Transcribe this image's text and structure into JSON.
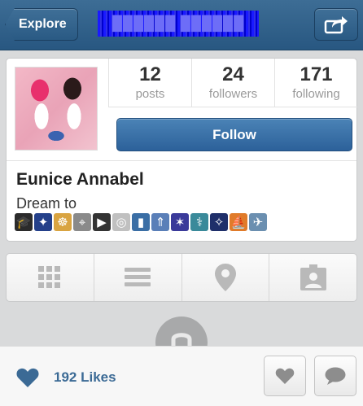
{
  "navbar": {
    "back_label": "Explore",
    "title": "██████ ██████"
  },
  "profile": {
    "stats": [
      {
        "value": "12",
        "label": "posts"
      },
      {
        "value": "24",
        "label": "followers"
      },
      {
        "value": "171",
        "label": "following"
      }
    ],
    "follow_label": "Follow",
    "name": "Eunice Annabel",
    "bio": "Dream to",
    "bio_emojis": [
      {
        "icon": "graduation-cap-icon",
        "glyph": "🎓",
        "color": "#2b2b2b"
      },
      {
        "icon": "night-city-icon",
        "glyph": "✦",
        "color": "#24408a"
      },
      {
        "icon": "ferris-wheel-icon",
        "glyph": "☸",
        "color": "#d9a441"
      },
      {
        "icon": "satellite-icon",
        "glyph": "⌖",
        "color": "#8a8a8a"
      },
      {
        "icon": "movie-camera-icon",
        "glyph": "▶",
        "color": "#333333"
      },
      {
        "icon": "dvd-icon",
        "glyph": "◎",
        "color": "#c0c0c0"
      },
      {
        "icon": "mobile-phone-icon",
        "glyph": "▮",
        "color": "#3a6ea5"
      },
      {
        "icon": "rocket-icon",
        "glyph": "⇑",
        "color": "#5a7fb8"
      },
      {
        "icon": "atm-icon",
        "glyph": "✶",
        "color": "#3a3a9a"
      },
      {
        "icon": "statue-of-liberty-icon",
        "glyph": "⚕",
        "color": "#3a8a9a"
      },
      {
        "icon": "stars-city-icon",
        "glyph": "✧",
        "color": "#1f2f6a"
      },
      {
        "icon": "sailboat-icon",
        "glyph": "⛵",
        "color": "#e07b2a"
      },
      {
        "icon": "airplane-icon",
        "glyph": "✈",
        "color": "#6b8fb0"
      }
    ]
  },
  "view_tabs": [
    {
      "icon": "grid-icon"
    },
    {
      "icon": "list-icon"
    },
    {
      "icon": "map-pin-icon"
    },
    {
      "icon": "tagged-photos-icon"
    }
  ],
  "footer": {
    "likes_count": "192 Likes"
  },
  "colors": {
    "nav_blue": "#2d5d88",
    "follow_blue": "#3a72a8",
    "likes_text": "#3b6a95"
  }
}
